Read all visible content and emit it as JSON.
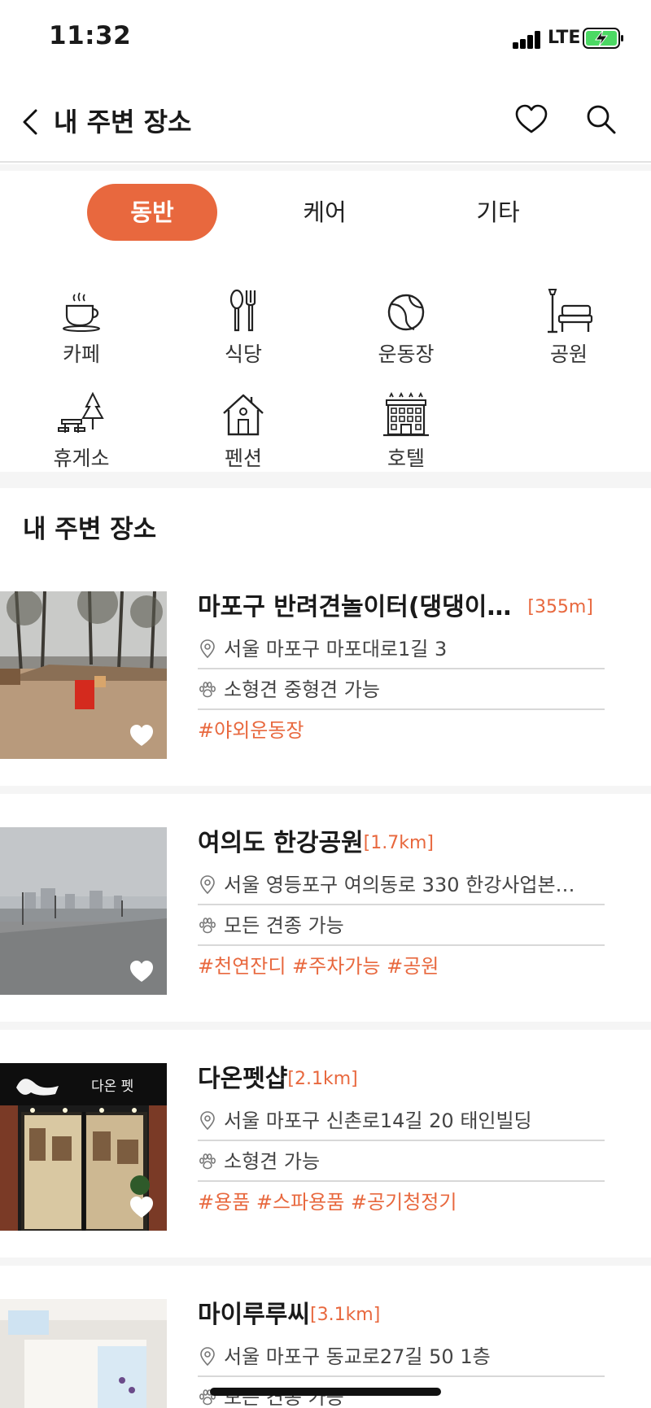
{
  "status": {
    "time": "11:32",
    "network": "LTE"
  },
  "nav": {
    "title": "내 주변 장소"
  },
  "tabs": [
    {
      "label": "동반",
      "active": true
    },
    {
      "label": "케어",
      "active": false
    },
    {
      "label": "기타",
      "active": false
    }
  ],
  "categories": [
    {
      "label": "카페",
      "icon": "coffee-cup-icon"
    },
    {
      "label": "식당",
      "icon": "fork-spoon-icon"
    },
    {
      "label": "운동장",
      "icon": "ball-icon"
    },
    {
      "label": "공원",
      "icon": "park-bench-icon"
    },
    {
      "label": "휴게소",
      "icon": "rest-area-icon"
    },
    {
      "label": "펜션",
      "icon": "house-icon"
    },
    {
      "label": "호텔",
      "icon": "hotel-icon"
    }
  ],
  "section": {
    "title": "내 주변 장소"
  },
  "places": [
    {
      "name": "마포구 반려견놀이터(댕댕이…",
      "distance": "[355m]",
      "address": "서울 마포구 마포대로1길 3",
      "pets": "소형견 중형견 가능",
      "tags": "#야외운동장"
    },
    {
      "name": "여의도 한강공원",
      "distance": "[1.7km]",
      "address": "서울 영등포구 여의동로 330 한강사업본…",
      "pets": "모든 견종 가능",
      "tags": "#천연잔디 #주차가능 #공원"
    },
    {
      "name": "다온펫샵",
      "distance": "[2.1km]",
      "address": "서울 마포구 신촌로14길 20 태인빌딩",
      "pets": "소형견 가능",
      "tags": "#용품 #스파용품 #공기청정기",
      "sign_text": "다온 펫"
    },
    {
      "name": "마이루루씨",
      "distance": "[3.1km]",
      "address": "서울 마포구 동교로27길 50 1층",
      "pets": "모든 견종 가능",
      "tags": ""
    }
  ],
  "colors": {
    "accent": "#e8683e",
    "divider": "#d8d8d8",
    "gap": "#f5f5f5"
  }
}
